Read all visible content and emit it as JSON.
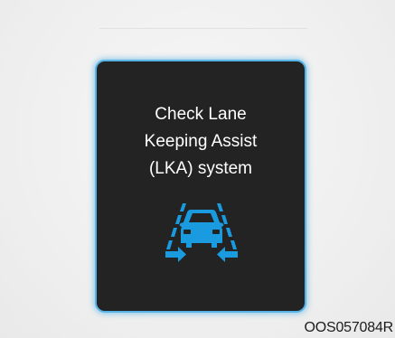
{
  "display": {
    "message_lines": [
      "Check Lane",
      "Keeping Assist",
      "(LKA) system"
    ],
    "icon": "lane-keeping-assist-icon",
    "icon_color": "#1a9be0",
    "border_color": "#58b4e6",
    "panel_color": "#232323"
  },
  "caption": {
    "code": "OOS057084R"
  }
}
